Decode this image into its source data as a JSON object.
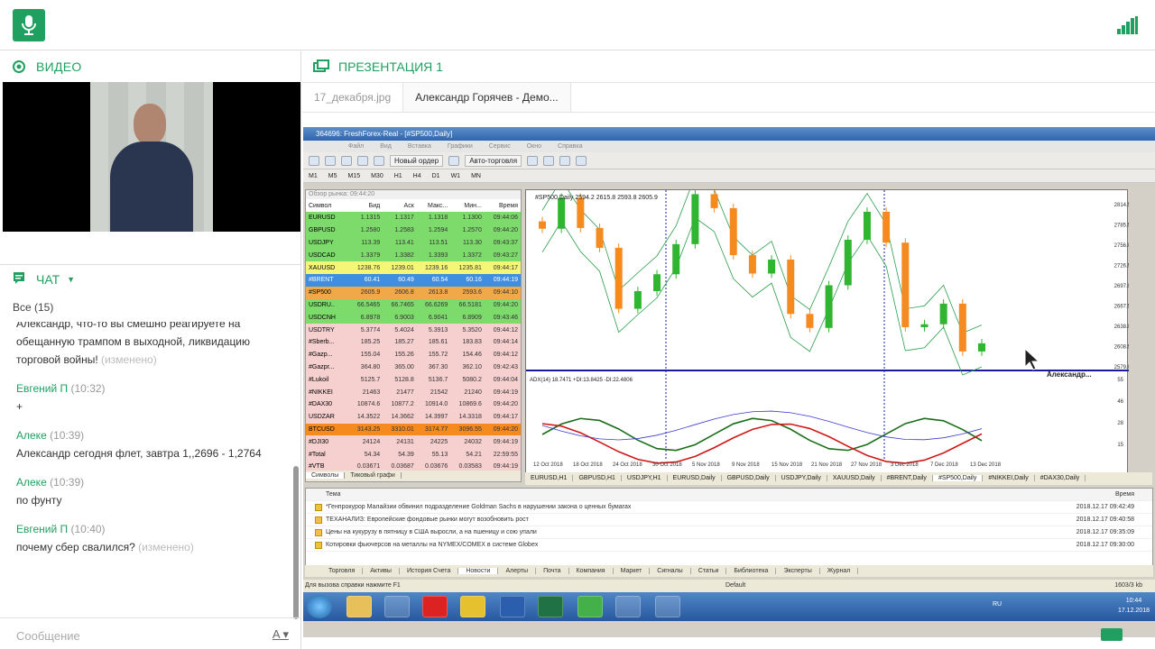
{
  "left": {
    "video_title": "ВИДЕО",
    "chat_title": "ЧАТ",
    "chat_filter": "Все (15)",
    "messages": [
      {
        "who": "",
        "time": "",
        "text": "Александр, что-то вы смешно реагируете на обещанную трампом в выходной, ликвидацию торговой войны!",
        "edited": "(изменено)"
      },
      {
        "who": "Евгений  П",
        "time": "(10:32)",
        "text": "+",
        "edited": ""
      },
      {
        "who": "Алеке",
        "time": "(10:39)",
        "text": "Александр сегодня флет, завтра 1,,2696 - 1,2764",
        "edited": ""
      },
      {
        "who": "Алеке",
        "time": "(10:39)",
        "text": "по фунту",
        "edited": ""
      },
      {
        "who": "Евгений  П",
        "time": "(10:40)",
        "text": "почему сбер свалился?",
        "edited": "(изменено)"
      }
    ],
    "compose_placeholder": "Сообщение",
    "format_label": "A"
  },
  "right": {
    "pres_title": "ПРЕЗЕНТАЦИЯ 1",
    "tabs": [
      "17_декабря.jpg",
      "Александр  Горячев - Демо..."
    ],
    "mt": {
      "title": "364696: FreshForex-Real - [#SP500,Daily]",
      "menu": [
        "Файл",
        "Вид",
        "Вставка",
        "Графики",
        "Сервис",
        "Окно",
        "Справка"
      ],
      "new_order": "Новый ордер",
      "autotrade": "Авто-торговля",
      "periods": [
        "M1",
        "M5",
        "M15",
        "M30",
        "H1",
        "H4",
        "D1",
        "W1",
        "MN"
      ],
      "mw_title": "Обзор рынка: 09:44:20",
      "mw_cols": [
        "Символ",
        "Бид",
        "Аск",
        "Макс...",
        "Мин...",
        "Время"
      ],
      "mw_rows": [
        [
          "EURUSD",
          "1.1315",
          "1.1317",
          "1.1318",
          "1.1300",
          "09:44:06",
          "#7ddb6b"
        ],
        [
          "GBPUSD",
          "1.2580",
          "1.2583",
          "1.2594",
          "1.2570",
          "09:44:20",
          "#7ddb6b"
        ],
        [
          "USDJPY",
          "113.39",
          "113.41",
          "113.51",
          "113.30",
          "09:43:37",
          "#7ddb6b"
        ],
        [
          "USDCAD",
          "1.3379",
          "1.3382",
          "1.3393",
          "1.3372",
          "09:43:27",
          "#7ddb6b"
        ],
        [
          "XAUUSD",
          "1238.76",
          "1239.01",
          "1239.16",
          "1235.81",
          "09:44:17",
          "#f5f577"
        ],
        [
          "#BRENT",
          "60.41",
          "60.49",
          "60.54",
          "60.16",
          "09:44:19",
          "#3f8fe0"
        ],
        [
          "#SP500",
          "2605.9",
          "2606.8",
          "2613.8",
          "2593.6",
          "09:44:10",
          "#f0a848"
        ],
        [
          "USDRU..",
          "66.5465",
          "66.7465",
          "66.6269",
          "66.5181",
          "09:44:20",
          "#7ddb6b"
        ],
        [
          "USDCNH",
          "6.8978",
          "6.9003",
          "6.9041",
          "6.8909",
          "09:43:46",
          "#7ddb6b"
        ],
        [
          "USDTRY",
          "5.3774",
          "5.4024",
          "5.3913",
          "5.3520",
          "09:44:12",
          "#f6cfcf"
        ],
        [
          "#Sberb...",
          "185.25",
          "185.27",
          "185.61",
          "183.83",
          "09:44:14",
          "#f6cfcf"
        ],
        [
          "#Gazp...",
          "155.04",
          "155.26",
          "155.72",
          "154.46",
          "09:44:12",
          "#f6cfcf"
        ],
        [
          "#Gazpr...",
          "364.80",
          "365.00",
          "367.30",
          "362.10",
          "09:42:43",
          "#f6cfcf"
        ],
        [
          "#Lukoil",
          "5125.7",
          "5128.8",
          "5136.7",
          "5080.2",
          "09:44:04",
          "#f6cfcf"
        ],
        [
          "#NIKKEI",
          "21463",
          "21477",
          "21542",
          "21240",
          "09:44:19",
          "#f6cfcf"
        ],
        [
          "#DAX30",
          "10874.6",
          "10877.2",
          "10914.0",
          "10869.6",
          "09:44:20",
          "#f6cfcf"
        ],
        [
          "USDZAR",
          "14.3522",
          "14.3662",
          "14.3997",
          "14.3318",
          "09:44:17",
          "#f6cfcf"
        ],
        [
          "BTCUSD",
          "3143.25",
          "3310.01",
          "3174.77",
          "3096.55",
          "09:44:20",
          "#f58a1e"
        ],
        [
          "#DJI30",
          "24124",
          "24131",
          "24225",
          "24032",
          "09:44:19",
          "#f6cfcf"
        ],
        [
          "#Total",
          "54.34",
          "54.39",
          "55.13",
          "54.21",
          "22:59:55",
          "#f6cfcf"
        ],
        [
          "#VTB",
          "0.03671",
          "0.03687",
          "0.03676",
          "0.03583",
          "09:44:19",
          "#f6cfcf"
        ]
      ],
      "mw_tabs": [
        "Символы",
        "Тиковый графи"
      ],
      "chart_label": "#SP500,Daily 2594.2 2615.8 2593.8 2605.9",
      "adx_label": "ADX(14) 18.7471 +DI:13.8425 -DI:22.4806",
      "price_ticks": [
        "2814.5",
        "2785.5",
        "2756.0",
        "2726.5",
        "2697.0",
        "2667.5",
        "2638.0",
        "2608.5",
        "2579.0"
      ],
      "adx_ticks": [
        "55",
        "46",
        "28",
        "15"
      ],
      "date_ticks": [
        "12 Oct 2018",
        "18 Oct 2018",
        "24 Oct 2018",
        "30 Oct 2018",
        "5 Nov 2018",
        "9 Nov 2018",
        "15 Nov 2018",
        "21 Nov 2018",
        "27 Nov 2018",
        "3 Dec 2018",
        "7 Dec 2018",
        "13 Dec 2018"
      ],
      "cursor_label": "Александр...",
      "chart_tabs": [
        "EURUSD,H1",
        "GBPUSD,H1",
        "USDJPY,H1",
        "EURUSD,Daily",
        "GBPUSD,Daily",
        "USDJPY,Daily",
        "XAUUSD,Daily",
        "#BRENT,Daily",
        "#SP500,Daily",
        "#NIKKEI,Daily",
        "#DAX30,Daily"
      ],
      "news_head": [
        "Тема",
        "Время"
      ],
      "news": [
        [
          "*Генпрокурор Малайзии обвинил подразделение Goldman Sachs в нарушении закона о ценных бумагах",
          "2018.12.17 09:42:49"
        ],
        [
          "ТЕХАНАЛИЗ: Европейские фондовые рынки могут возобновить рост",
          "2018.12.17 09:40:58"
        ],
        [
          "Цены на кукурузу в пятницу в США выросли, а на пшеницу и сою упали",
          "2018.12.17 09:35:09"
        ],
        [
          "Котировки фьючерсов на металлы на NYMEX/COMEX в системе Globex",
          "2018.12.17 09:30:00"
        ]
      ],
      "term_tabs": [
        "Торговля",
        "Активы",
        "История Счета",
        "Новости",
        "Алерты",
        "Почта",
        "Компания",
        "Маркет",
        "Сигналы",
        "Статьи",
        "Библиотека",
        "Эксперты",
        "Журнал"
      ],
      "status_help": "Для вызова справки нажмите F1",
      "status_default": "Default",
      "status_kb": "1603/3 kb",
      "tray_lang": "RU",
      "tray_time": "10:44",
      "tray_date": "17.12.2018"
    }
  },
  "chart_data": {
    "type": "candlestick",
    "title": "#SP500,Daily",
    "x": [
      "12 Oct 2018",
      "18 Oct 2018",
      "24 Oct 2018",
      "30 Oct 2018",
      "5 Nov 2018",
      "9 Nov 2018",
      "15 Nov 2018",
      "21 Nov 2018",
      "27 Nov 2018",
      "3 Dec 2018",
      "7 Dec 2018",
      "13 Dec 2018"
    ],
    "ylim": [
      2579.0,
      2814.5
    ],
    "close": [
      2767,
      2809,
      2768,
      2741,
      2658,
      2682,
      2705,
      2746,
      2814,
      2795,
      2731,
      2706,
      2725,
      2651,
      2632,
      2690,
      2752,
      2790,
      2748,
      2633,
      2637,
      2665,
      2600,
      2611
    ]
  }
}
